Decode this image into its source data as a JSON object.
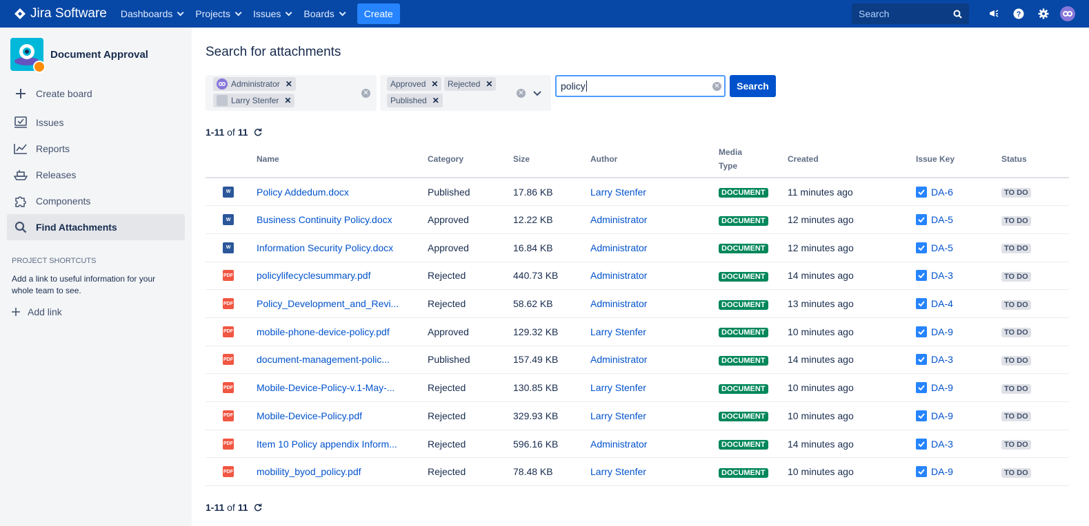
{
  "topnav": {
    "brand": "Jira Software",
    "menus": [
      "Dashboards",
      "Projects",
      "Issues",
      "Boards"
    ],
    "create_label": "Create",
    "search_placeholder": "Search"
  },
  "sidebar": {
    "project_name": "Document Approval",
    "items": [
      {
        "label": "Create board",
        "icon": "plus-icon"
      },
      {
        "label": "Issues",
        "icon": "issues-icon"
      },
      {
        "label": "Reports",
        "icon": "reports-icon"
      },
      {
        "label": "Releases",
        "icon": "ship-icon"
      },
      {
        "label": "Components",
        "icon": "puzzle-icon"
      },
      {
        "label": "Find Attachments",
        "icon": "search-icon",
        "active": true
      }
    ],
    "shortcuts_title": "PROJECT SHORTCUTS",
    "shortcuts_text": "Add a link to useful information for your whole team to see.",
    "add_link": "Add link"
  },
  "main": {
    "title": "Search for attachments",
    "author_filter": [
      "Administrator",
      "Larry Stenfer"
    ],
    "category_filter": [
      "Approved",
      "Rejected",
      "Published"
    ],
    "search_value": "policy",
    "search_button": "Search",
    "pager": {
      "range": "1-11",
      "of": "of",
      "total": "11"
    },
    "columns": [
      "Name",
      "Category",
      "Size",
      "Author",
      "Media Type",
      "Created",
      "Issue Key",
      "Status"
    ],
    "rows": [
      {
        "type": "docx",
        "name": "Policy Addedum.docx",
        "category": "Published",
        "size": "17.86 KB",
        "author": "Larry Stenfer",
        "media": "DOCUMENT",
        "created": "11 minutes ago",
        "key": "DA-6",
        "status": "TO DO"
      },
      {
        "type": "docx",
        "name": "Business Continuity Policy.docx",
        "category": "Approved",
        "size": "12.22 KB",
        "author": "Administrator",
        "media": "DOCUMENT",
        "created": "12 minutes ago",
        "key": "DA-5",
        "status": "TO DO"
      },
      {
        "type": "docx",
        "name": "Information Security Policy.docx",
        "category": "Approved",
        "size": "16.84 KB",
        "author": "Administrator",
        "media": "DOCUMENT",
        "created": "12 minutes ago",
        "key": "DA-5",
        "status": "TO DO"
      },
      {
        "type": "pdf",
        "name": "policylifecyclesummary.pdf",
        "category": "Rejected",
        "size": "440.73 KB",
        "author": "Administrator",
        "media": "DOCUMENT",
        "created": "14 minutes ago",
        "key": "DA-3",
        "status": "TO DO"
      },
      {
        "type": "pdf",
        "name": "Policy_Development_and_Revi...",
        "category": "Rejected",
        "size": "58.62 KB",
        "author": "Administrator",
        "media": "DOCUMENT",
        "created": "13 minutes ago",
        "key": "DA-4",
        "status": "TO DO"
      },
      {
        "type": "pdf",
        "name": "mobile-phone-device-policy.pdf",
        "category": "Approved",
        "size": "129.32 KB",
        "author": "Larry Stenfer",
        "media": "DOCUMENT",
        "created": "10 minutes ago",
        "key": "DA-9",
        "status": "TO DO"
      },
      {
        "type": "pdf",
        "name": "document-management-polic...",
        "category": "Published",
        "size": "157.49 KB",
        "author": "Administrator",
        "media": "DOCUMENT",
        "created": "14 minutes ago",
        "key": "DA-3",
        "status": "TO DO"
      },
      {
        "type": "pdf",
        "name": "Mobile-Device-Policy-v.1-May-...",
        "category": "Rejected",
        "size": "130.85 KB",
        "author": "Larry Stenfer",
        "media": "DOCUMENT",
        "created": "10 minutes ago",
        "key": "DA-9",
        "status": "TO DO"
      },
      {
        "type": "pdf",
        "name": "Mobile-Device-Policy.pdf",
        "category": "Rejected",
        "size": "329.93 KB",
        "author": "Larry Stenfer",
        "media": "DOCUMENT",
        "created": "10 minutes ago",
        "key": "DA-9",
        "status": "TO DO"
      },
      {
        "type": "pdf",
        "name": "Item 10 Policy appendix Inform...",
        "category": "Rejected",
        "size": "596.16 KB",
        "author": "Administrator",
        "media": "DOCUMENT",
        "created": "14 minutes ago",
        "key": "DA-3",
        "status": "TO DO"
      },
      {
        "type": "pdf",
        "name": "mobility_byod_policy.pdf",
        "category": "Rejected",
        "size": "78.48 KB",
        "author": "Larry Stenfer",
        "media": "DOCUMENT",
        "created": "10 minutes ago",
        "key": "DA-9",
        "status": "TO DO"
      }
    ]
  }
}
